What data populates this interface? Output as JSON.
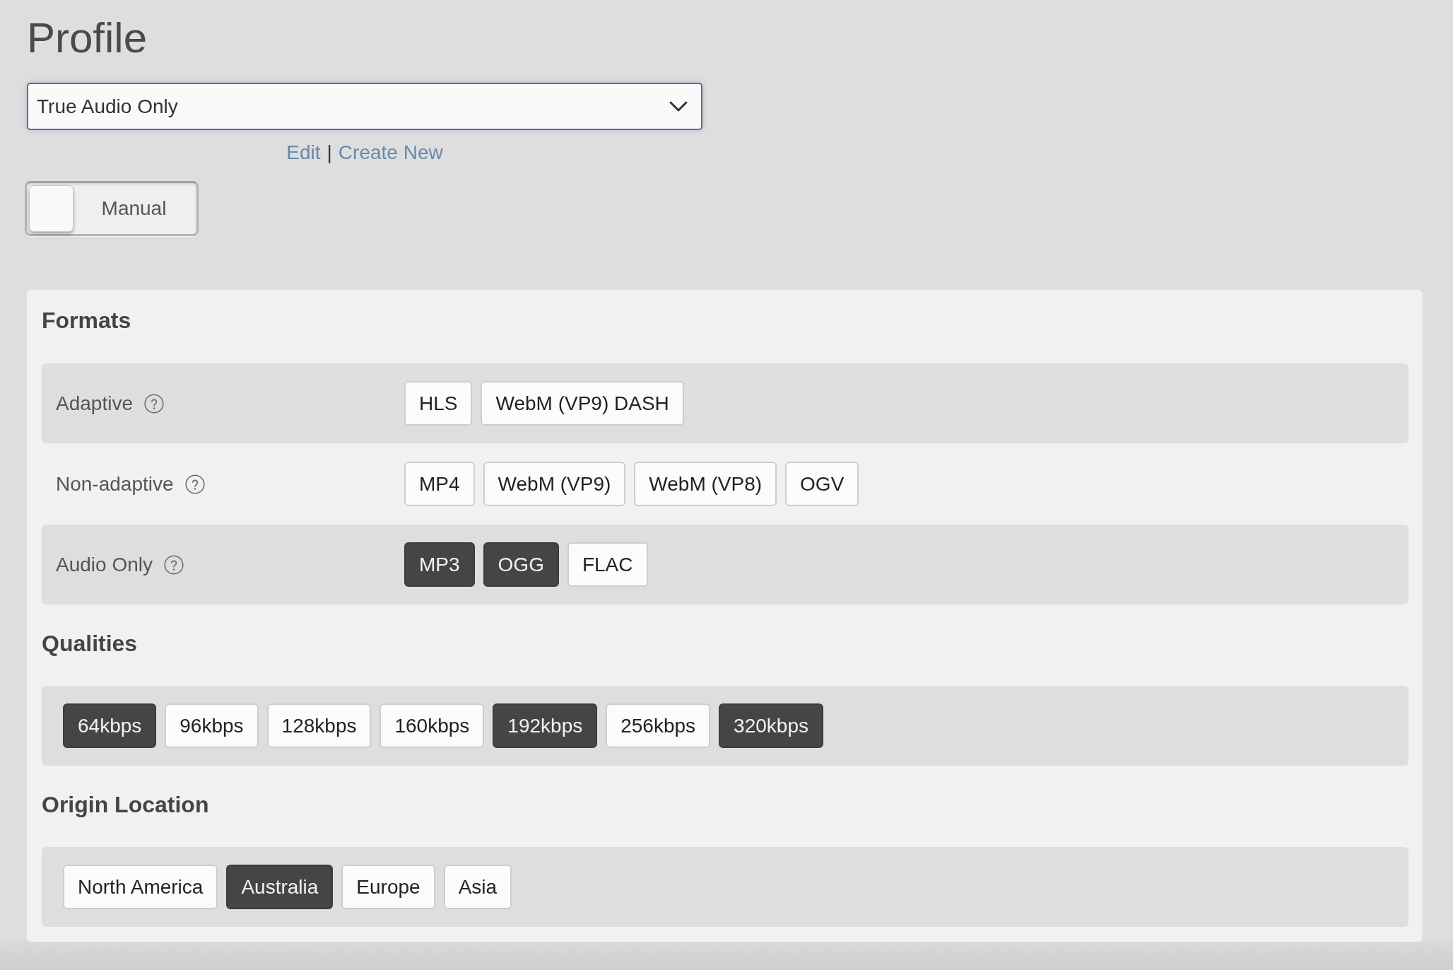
{
  "title": "Profile",
  "profile_select": {
    "value": "True Audio Only"
  },
  "profile_links": [
    {
      "label": "Edit"
    },
    {
      "label": "Create New"
    }
  ],
  "link_separator": "|",
  "mode_toggle": {
    "label": "Manual",
    "on": false
  },
  "sections": [
    {
      "title": "Formats",
      "kind": "labeled_rows",
      "rows": [
        {
          "label": "Adaptive",
          "options": [
            {
              "label": "HLS",
              "selected": false
            },
            {
              "label": "WebM (VP9) DASH",
              "selected": false
            }
          ]
        },
        {
          "label": "Non-adaptive",
          "options": [
            {
              "label": "MP4",
              "selected": false
            },
            {
              "label": "WebM (VP9)",
              "selected": false
            },
            {
              "label": "WebM (VP8)",
              "selected": false
            },
            {
              "label": "OGV",
              "selected": false
            }
          ]
        },
        {
          "label": "Audio Only",
          "options": [
            {
              "label": "MP3",
              "selected": true
            },
            {
              "label": "OGG",
              "selected": true
            },
            {
              "label": "FLAC",
              "selected": false
            }
          ]
        }
      ]
    },
    {
      "title": "Qualities",
      "kind": "options",
      "options": [
        {
          "label": "64kbps",
          "selected": true
        },
        {
          "label": "96kbps",
          "selected": false
        },
        {
          "label": "128kbps",
          "selected": false
        },
        {
          "label": "160kbps",
          "selected": false
        },
        {
          "label": "192kbps",
          "selected": true
        },
        {
          "label": "256kbps",
          "selected": false
        },
        {
          "label": "320kbps",
          "selected": true
        }
      ]
    },
    {
      "title": "Origin Location",
      "kind": "options",
      "options": [
        {
          "label": "North America",
          "selected": false
        },
        {
          "label": "Australia",
          "selected": true
        },
        {
          "label": "Europe",
          "selected": false
        },
        {
          "label": "Asia",
          "selected": false
        }
      ]
    }
  ]
}
